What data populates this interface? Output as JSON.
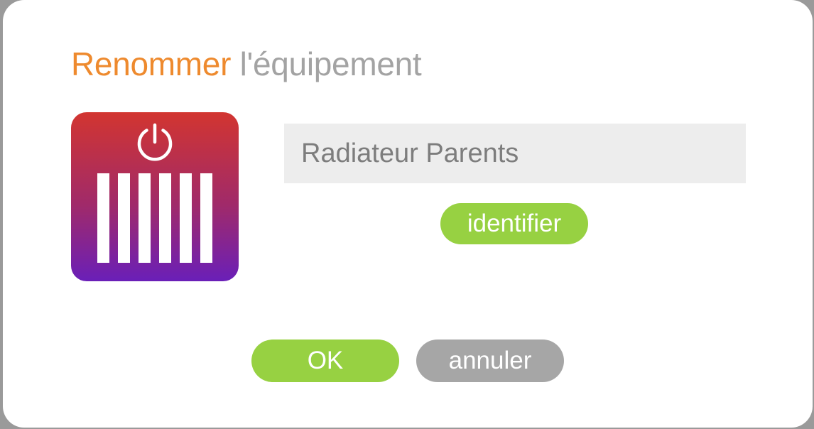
{
  "dialog": {
    "title_accent": "Renommer",
    "title_rest": " l'équipement",
    "accent_color": "#ee8a2e",
    "title_rest_color": "#a3a3a3",
    "device_icon": "radiator-power-icon",
    "name_field": {
      "value": "Radiateur Parents",
      "placeholder": ""
    },
    "identify_label": "identifier",
    "ok_label": "OK",
    "cancel_label": "annuler",
    "primary_button_color": "#97d142",
    "secondary_button_color": "#a6a6a6"
  }
}
